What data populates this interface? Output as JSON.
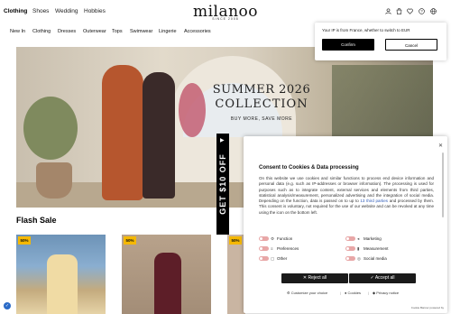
{
  "header": {
    "categories": [
      "Clothing",
      "Shoes",
      "Wedding",
      "Hobbies"
    ],
    "logo": "milanoo",
    "logo_sub": "SINCE 2008"
  },
  "nav": {
    "items": [
      "New In",
      "Clothing",
      "Dresses",
      "Outerwear",
      "Tops",
      "Swimwear",
      "Lingerie",
      "Accessories"
    ]
  },
  "hero": {
    "title_line1": "SUMMER 2026",
    "title_line2": "COLLECTION",
    "cta": "BUY MORE, SAVE MORE"
  },
  "promo_tab": {
    "label": "GET $10 OFF"
  },
  "flash_sale": {
    "title": "Flash Sale",
    "products": [
      {
        "badge": "50%"
      },
      {
        "badge": "50%"
      },
      {
        "badge": "50%"
      }
    ]
  },
  "ip_popup": {
    "text": "Your IP is from France, whether to switch to EUR",
    "confirm": "Confirm",
    "cancel": "Cancel"
  },
  "cookie_dialog": {
    "title": "Consent to Cookies & Data processing",
    "body_before_link": "On this website we use cookies and similar functions to process end device information and personal data (e.g. such as IP-addresses or browser information). The processing is used for purposes such as to integrate content, external services and elements from third parties, statistical analysis/measurement, personalized advertising and the integration of social media. Depending on the function, data is passed on to up to ",
    "link_text": "13 third parties",
    "body_after_link": " and processed by them. This consent is voluntary, not required for the use of our website and can be revoked at any time using the icon on the bottom left.",
    "toggles_left": [
      "Function",
      "Preferences",
      "Other"
    ],
    "toggles_right": [
      "Marketing",
      "Measurement",
      "Social media"
    ],
    "reject": "Reject all",
    "accept": "Accept all",
    "customize": "Customize your choice",
    "cookies": "Cookies",
    "privacy": "Privacy notice",
    "powered": "Cookie Banner powered by"
  }
}
